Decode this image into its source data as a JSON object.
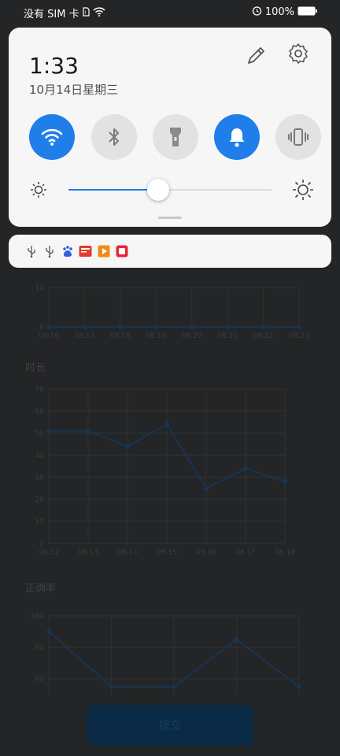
{
  "status_bar": {
    "carrier": "没有 SIM 卡",
    "battery": "100%"
  },
  "quick_settings": {
    "time": "1:33",
    "date": "10月14日星期三",
    "tiles": [
      {
        "name": "wifi",
        "state": "on"
      },
      {
        "name": "bluetooth",
        "state": "off"
      },
      {
        "name": "flashlight",
        "state": "off"
      },
      {
        "name": "sound",
        "state": "on"
      },
      {
        "name": "vibrate",
        "state": "off"
      }
    ],
    "brightness": 0.44
  },
  "notification_icons": [
    "usb-icon",
    "usb-debug-icon",
    "baidu-icon",
    "news-app-icon",
    "video-app-icon",
    "red-app-icon"
  ],
  "background_app": {
    "charts": [
      {
        "title": "",
        "y_ticks": [
          "10",
          "0"
        ],
        "x_ticks": [
          "08.16",
          "08.17",
          "08.18",
          "08.19",
          "08.20",
          "08.21",
          "08.22",
          "08.23"
        ]
      },
      {
        "title": "时长",
        "y_ticks": [
          "70",
          "60",
          "50",
          "40",
          "30",
          "20",
          "10",
          "0"
        ],
        "x_ticks": [
          "08.12",
          "08.13",
          "08.14",
          "08.15",
          "08.16",
          "08.17",
          "08.18"
        ]
      },
      {
        "title": "正确率",
        "y_ticks": [
          "100",
          "80",
          "60"
        ],
        "x_ticks": []
      }
    ],
    "submit_label": "提交"
  },
  "colors": {
    "accent": "#1f7ee9",
    "panel": "#f6f6f6",
    "tile_off": "#e2e2e2",
    "dim_background": "#242526"
  },
  "chart_data": [
    {
      "type": "line",
      "title": "",
      "x": [
        "08.16",
        "08.17",
        "08.18",
        "08.19",
        "08.20",
        "08.21",
        "08.22",
        "08.23"
      ],
      "values": [
        0,
        0,
        0,
        0,
        0,
        0,
        0,
        0
      ],
      "ylim": [
        0,
        10
      ],
      "grid": true
    },
    {
      "type": "line",
      "title": "时长",
      "x": [
        "08.12",
        "08.13",
        "08.14",
        "08.15",
        "08.16",
        "08.17",
        "08.18"
      ],
      "values": [
        51,
        51,
        44,
        54,
        25,
        34,
        28
      ],
      "ylim": [
        0,
        70
      ],
      "grid": true
    },
    {
      "type": "line",
      "title": "正确率",
      "values": [
        90,
        55,
        55,
        85,
        55
      ],
      "ylim": [
        50,
        100
      ],
      "grid": true
    }
  ]
}
